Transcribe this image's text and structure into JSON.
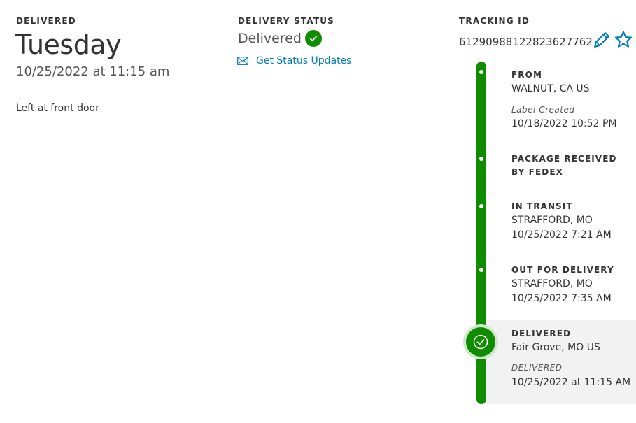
{
  "delivered_section": {
    "label": "DELIVERED",
    "day": "Tuesday",
    "datetime": "10/25/2022 at 11:15 am",
    "note": "Left at front door"
  },
  "status_section": {
    "label": "DELIVERY STATUS",
    "status": "Delivered",
    "updates_link": "Get Status Updates"
  },
  "tracking_section": {
    "label": "TRACKING ID",
    "id": "61290988122823627762"
  },
  "timeline": [
    {
      "title": "FROM",
      "location": "WALNUT, CA US",
      "sub": "Label Created",
      "time": "10/18/2022 10:52 PM"
    },
    {
      "title": "PACKAGE RECEIVED BY FEDEX"
    },
    {
      "title": "IN TRANSIT",
      "location": "STRAFFORD, MO",
      "time": "10/25/2022 7:21 AM"
    },
    {
      "title": "OUT FOR DELIVERY",
      "location": "STRAFFORD, MO",
      "time": "10/25/2022 7:35 AM"
    },
    {
      "title": "DELIVERED",
      "location": "Fair Grove, MO US",
      "sub": "DELIVERED",
      "time": "10/25/2022 at 11:15 AM"
    }
  ],
  "colors": {
    "accent_green": "#0f8c00",
    "link_blue": "#007ab7"
  },
  "icons": [
    "check-circle-icon",
    "envelope-icon",
    "pencil-icon",
    "star-icon"
  ]
}
